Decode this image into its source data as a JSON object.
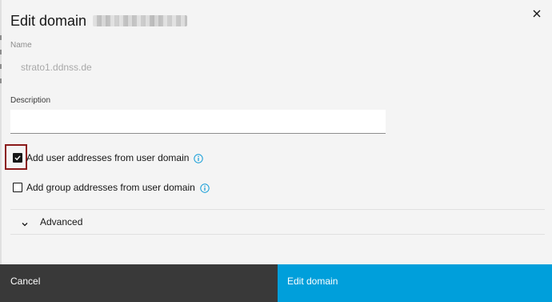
{
  "modal": {
    "title": "Edit domain",
    "close_icon": "close-icon"
  },
  "fields": {
    "name_label": "Name",
    "name_value": "strato1.ddnss.de",
    "description_label": "Description",
    "description_value": ""
  },
  "options": [
    {
      "label": "Add user addresses from user domain",
      "checked": true,
      "icon": "info-icon"
    },
    {
      "label": "Add group addresses from user domain",
      "checked": false,
      "icon": "info-icon"
    }
  ],
  "advanced": {
    "label": "Advanced",
    "icon": "chevron-down-icon"
  },
  "footer": {
    "cancel_label": "Cancel",
    "primary_label": "Edit domain"
  },
  "colors": {
    "primary": "#009fdb",
    "secondary": "#393939",
    "highlight": "#8b1a1a",
    "info": "#0f9bd7"
  }
}
